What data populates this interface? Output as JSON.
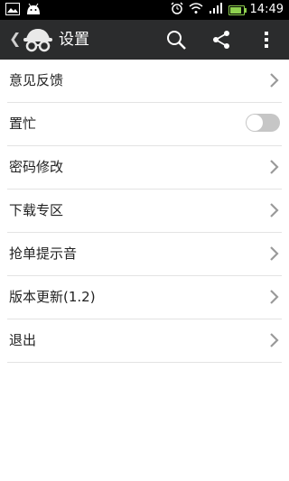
{
  "status_bar": {
    "time": "14:49",
    "icons": [
      "image-icon",
      "android-icon",
      "alarm-icon",
      "wifi-icon",
      "signal-icon",
      "battery-icon"
    ]
  },
  "action_bar": {
    "title": "设置",
    "icons": [
      "back-chevron-icon",
      "app-logo-icon",
      "search-icon",
      "share-icon",
      "overflow-menu-icon"
    ]
  },
  "settings": {
    "items": [
      {
        "label": "意见反馈",
        "control": "chevron"
      },
      {
        "label": "置忙",
        "control": "toggle",
        "checked": false
      },
      {
        "label": "密码修改",
        "control": "chevron"
      },
      {
        "label": "下载专区",
        "control": "chevron"
      },
      {
        "label": "抢单提示音",
        "control": "chevron"
      },
      {
        "label": "版本更新(1.2)",
        "control": "chevron"
      },
      {
        "label": "退出",
        "control": "chevron"
      }
    ]
  },
  "colors": {
    "action_bar": "#2b2c2d",
    "status_bar": "#000000",
    "divider": "#e3e3e3",
    "toggle_off": "#c6c6c6",
    "battery": "#8fd14f"
  }
}
